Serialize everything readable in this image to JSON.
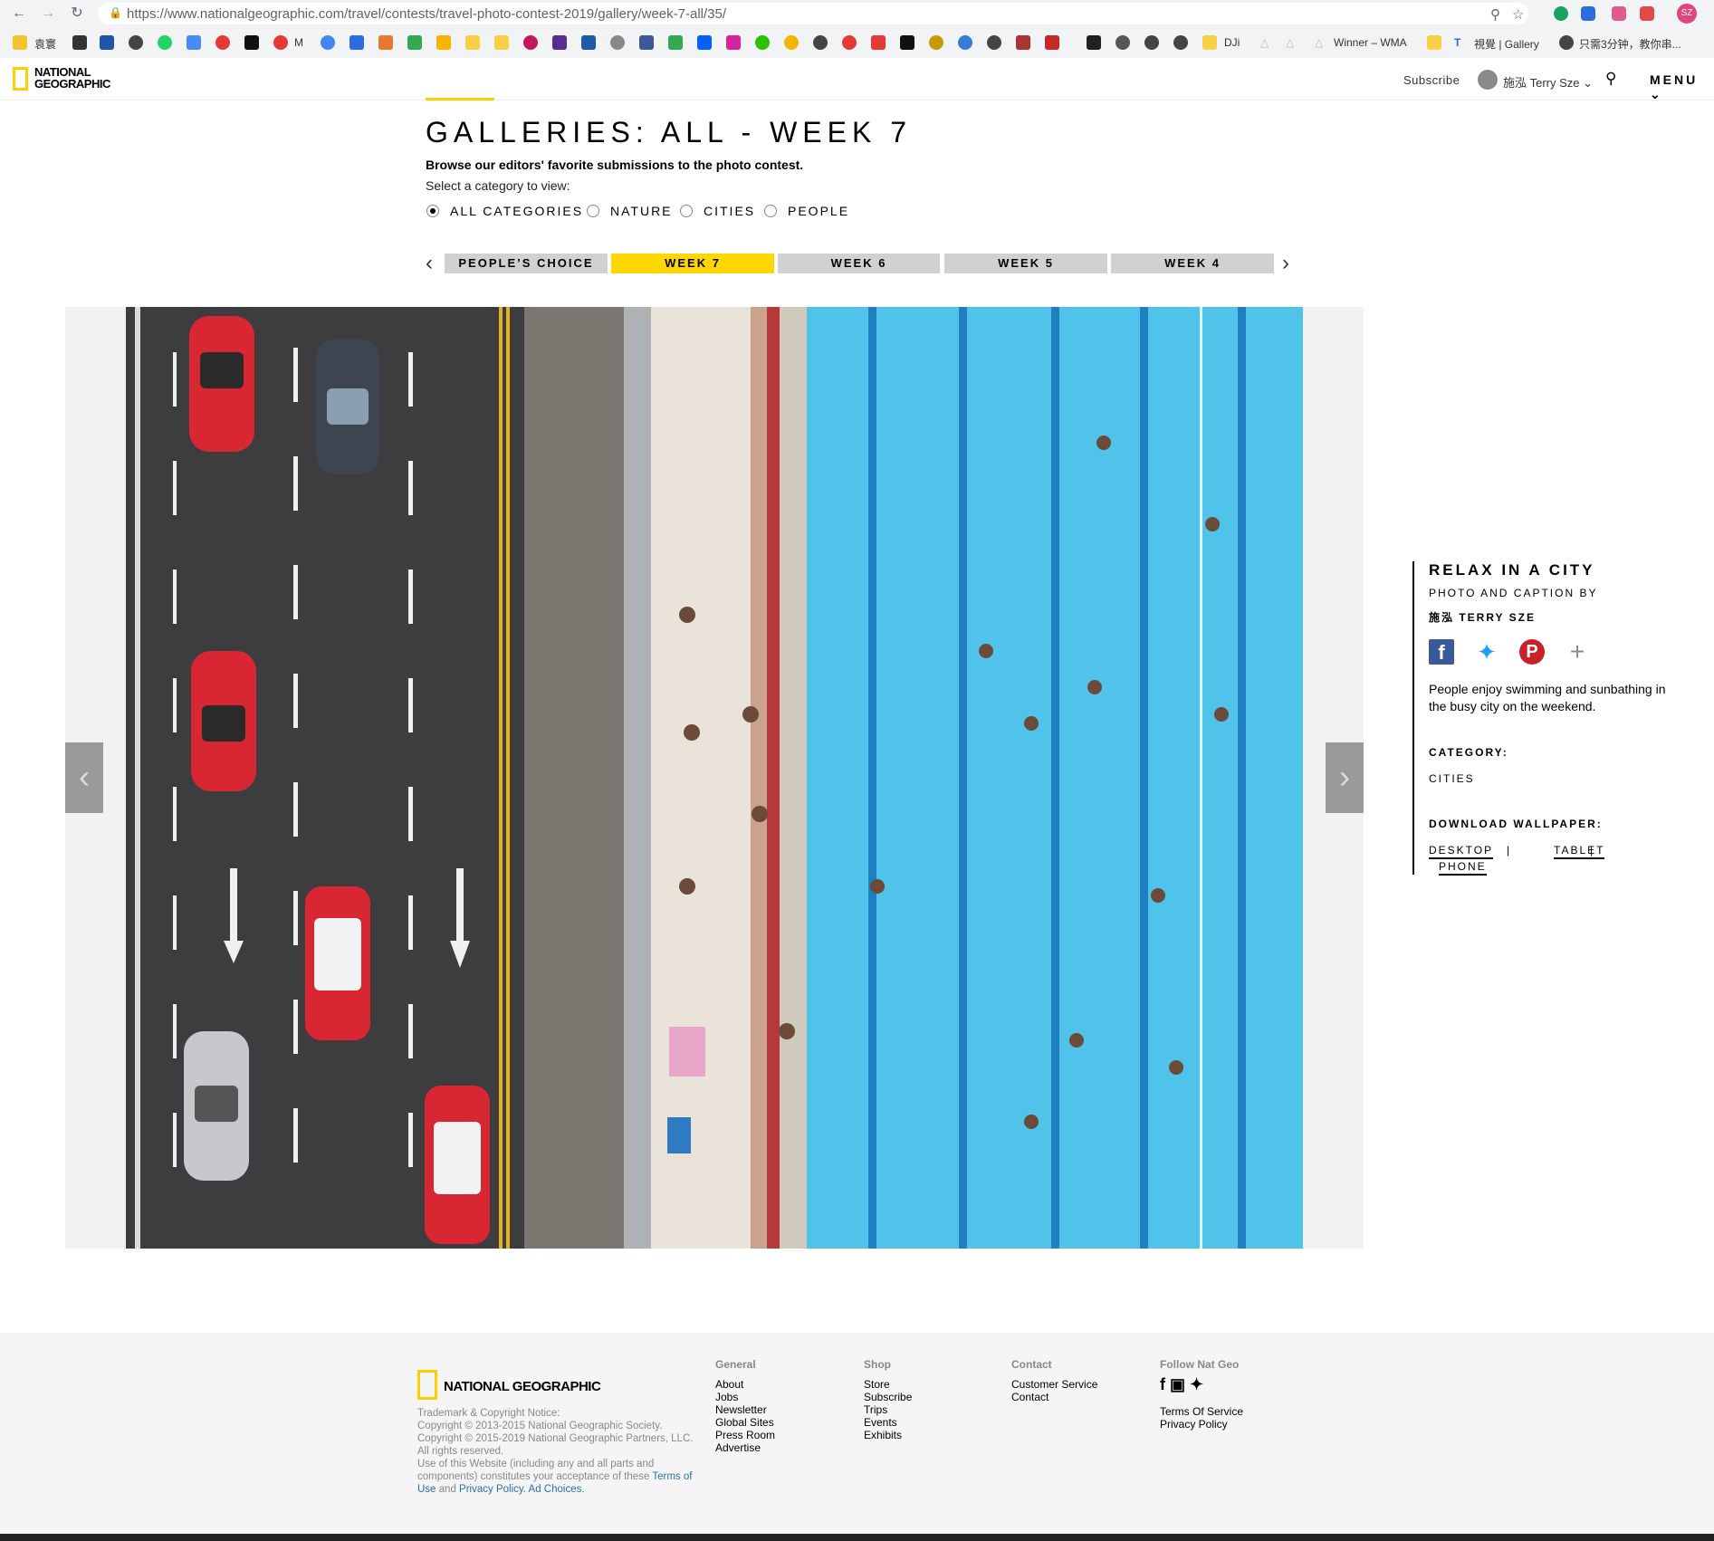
{
  "browser": {
    "url": "https://www.nationalgeographic.com/travel/contests/travel-photo-contest-2019/gallery/week-7-all/35/",
    "profile_initials": "SZ",
    "bookmarks": [
      "袁寰",
      "M",
      "DJi",
      "Winner – WMA",
      "視覺 | Gallery",
      "只需3分钟，教你串..."
    ]
  },
  "site": {
    "logo_line1": "NATIONAL",
    "logo_line2": "GEOGRAPHIC",
    "subscribe": "Subscribe",
    "user_name": "施泓 Terry Sze",
    "menu": "MENU"
  },
  "gallery": {
    "title": "GALLERIES: ALL - WEEK 7",
    "subtitle": "Browse our editors' favorite submissions to the photo contest.",
    "select_prompt": "Select a category to view:",
    "categories": [
      {
        "label": "ALL CATEGORIES",
        "selected": true
      },
      {
        "label": "NATURE",
        "selected": false
      },
      {
        "label": "CITIES",
        "selected": false
      },
      {
        "label": "PEOPLE",
        "selected": false
      }
    ],
    "tabs": [
      {
        "label": "PEOPLE’S CHOICE",
        "active": false
      },
      {
        "label": "WEEK 7",
        "active": true
      },
      {
        "label": "WEEK 6",
        "active": false
      },
      {
        "label": "WEEK 5",
        "active": false
      },
      {
        "label": "WEEK 4",
        "active": false
      }
    ]
  },
  "photo": {
    "title": "RELAX IN A CITY",
    "credit_label": "PHOTO AND CAPTION BY",
    "photographer": "施泓 TERRY SZE",
    "caption": "People enjoy swimming and sunbathing in the busy city on the weekend.",
    "category_label": "CATEGORY:",
    "category": "CITIES",
    "download_label": "DOWNLOAD WALLPAPER:",
    "downloads": [
      "DESKTOP",
      "TABLET",
      "PHONE"
    ],
    "separator": "|"
  },
  "footer": {
    "logo": "NATIONAL GEOGRAPHIC",
    "legal_1": "Trademark & Copyright Notice:",
    "legal_2": "Copyright © 2013-2015 National Geographic Society.",
    "legal_3": "Copyright © 2015-2019 National Geographic Partners, LLC.",
    "legal_4": "All rights reserved.",
    "legal_5": "Use of this Website (including any and all parts and components) constitutes your acceptance of these",
    "terms_link": "Terms of Use",
    "and": "and",
    "privacy_link": "Privacy Policy.",
    "adchoices_link": "Ad Choices.",
    "columns": [
      {
        "heading": "General",
        "links": [
          "About",
          "Jobs",
          "Newsletter",
          "Global Sites",
          "Press Room",
          "Advertise"
        ]
      },
      {
        "heading": "Shop",
        "links": [
          "Store",
          "Subscribe",
          "Trips",
          "Events",
          "Exhibits"
        ]
      },
      {
        "heading": "Contact",
        "links": [
          "Customer Service",
          "Contact"
        ]
      }
    ],
    "follow_heading": "Follow Nat Geo",
    "follow_links": [
      "Terms Of Service",
      "Privacy Policy"
    ]
  },
  "colors": {
    "accent_yellow": "#ffce00",
    "pool_blue": "#4fc3ea",
    "taxi_red": "#d92633"
  }
}
